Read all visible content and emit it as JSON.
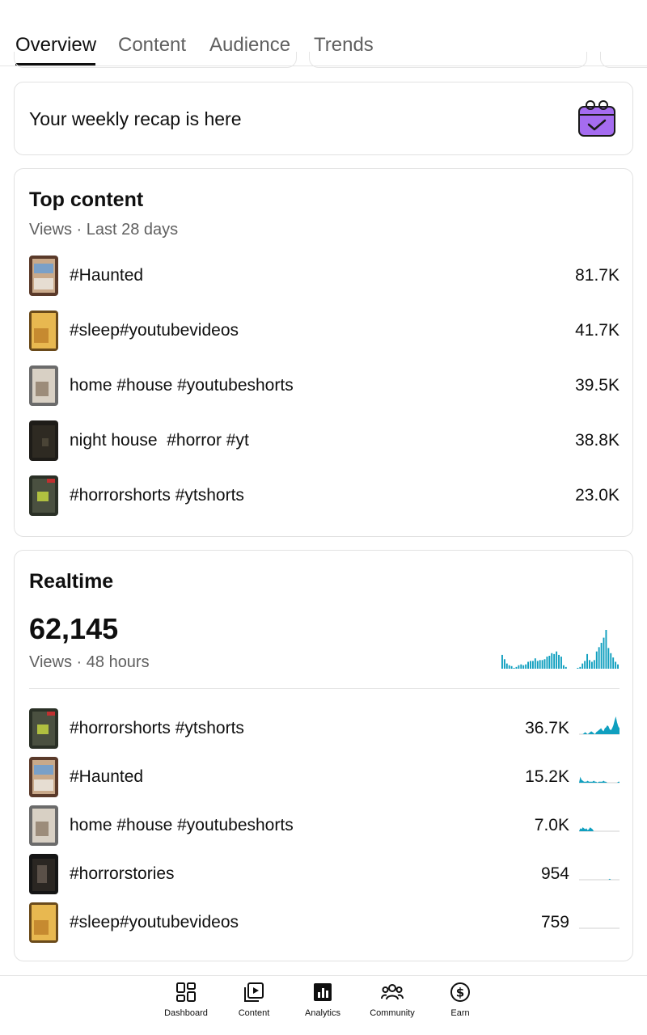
{
  "tabs": [
    "Overview",
    "Content",
    "Audience",
    "Trends"
  ],
  "recap": {
    "title": "Your weekly recap is here",
    "icon": "calendar-check-icon"
  },
  "top_content": {
    "title": "Top content",
    "subtitle": "Views · Last 28 days",
    "items": [
      {
        "title": "#Haunted",
        "value": "81.7K"
      },
      {
        "title": "#sleep#youtubevideos",
        "value": "41.7K"
      },
      {
        "title": "home #house #youtubeshorts",
        "value": "39.5K"
      },
      {
        "title": "night house  #horror #yt",
        "value": "38.8K"
      },
      {
        "title": "#horrorshorts #ytshorts",
        "value": "23.0K"
      }
    ]
  },
  "realtime": {
    "title": "Realtime",
    "views": "62,145",
    "subtitle": "Views · 48 hours",
    "chart_bars": [
      16,
      11,
      6,
      4,
      3,
      1,
      2,
      4,
      5,
      4,
      5,
      8,
      9,
      9,
      12,
      9,
      10,
      10,
      11,
      14,
      15,
      18,
      17,
      20,
      16,
      14,
      4,
      2,
      0,
      0,
      0,
      0,
      1,
      2,
      6,
      9,
      17,
      10,
      8,
      10,
      20,
      25,
      30,
      36,
      45,
      24,
      18,
      13,
      8,
      5
    ],
    "items": [
      {
        "title": "#horrorshorts #ytshorts",
        "value": "36.7K",
        "spark": [
          0,
          0,
          0,
          0,
          1,
          2,
          1,
          0,
          1,
          2,
          3,
          2,
          1,
          0,
          2,
          3,
          4,
          5,
          6,
          4,
          3,
          6,
          7,
          9,
          8,
          5,
          4,
          6,
          9,
          14,
          18,
          12,
          8,
          6
        ]
      },
      {
        "title": "#Haunted",
        "value": "15.2K",
        "spark": [
          0,
          6,
          3,
          2,
          1,
          1,
          1,
          2,
          1,
          1,
          1,
          1,
          2,
          1,
          1,
          0,
          1,
          1,
          1,
          1,
          2,
          1,
          1,
          0,
          0,
          0,
          0,
          0,
          0,
          0,
          0,
          0,
          1,
          1
        ]
      },
      {
        "title": "home #house #youtubeshorts",
        "value": "7.0K",
        "spark": [
          0,
          3,
          2,
          4,
          3,
          2,
          3,
          1,
          2,
          4,
          3,
          2,
          0,
          0,
          0,
          0,
          0,
          0,
          0,
          0,
          0,
          0,
          0,
          0,
          0,
          0,
          0,
          0,
          0,
          0,
          0,
          0,
          0,
          0
        ]
      },
      {
        "title": "#horrorstories",
        "value": "954",
        "spark": [
          0,
          0,
          0,
          0,
          0,
          0,
          0,
          0,
          0,
          0,
          0,
          0,
          0,
          0,
          0,
          0,
          0,
          0,
          0,
          0,
          0,
          0,
          0,
          0,
          0,
          1,
          0,
          0,
          0,
          0,
          0,
          0,
          0,
          0
        ]
      },
      {
        "title": "#sleep#youtubevideos",
        "value": "759",
        "spark": [
          0,
          0,
          0,
          0,
          0,
          0,
          0,
          0,
          0,
          0,
          0,
          0,
          0,
          0,
          0,
          0,
          0,
          0,
          0,
          0,
          0,
          0,
          0,
          0,
          0,
          0,
          0,
          0,
          0,
          0,
          0,
          0,
          0,
          0
        ]
      }
    ]
  },
  "bottom_nav": [
    {
      "label": "Dashboard",
      "icon": "dashboard-icon"
    },
    {
      "label": "Content",
      "icon": "play-library-icon"
    },
    {
      "label": "Analytics",
      "icon": "analytics-icon",
      "active": true
    },
    {
      "label": "Community",
      "icon": "community-icon"
    },
    {
      "label": "Earn",
      "icon": "dollar-icon"
    }
  ],
  "colors": {
    "accent": "#0f9fbf",
    "text": "#0f0f0f",
    "muted": "#606060",
    "recap_icon": "#a56cf0"
  }
}
